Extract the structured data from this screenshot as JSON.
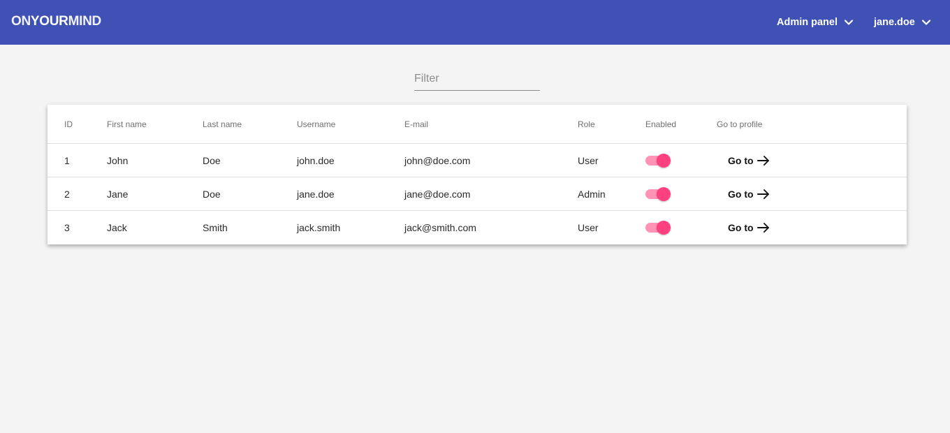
{
  "app": {
    "logo_part1": "ON",
    "logo_part2": "YOUR",
    "logo_part3": "MIND"
  },
  "toolbar": {
    "admin_menu_label": "Admin panel",
    "user_menu_label": "jane.doe",
    "chevron_icon": "chevron-down-icon"
  },
  "filter": {
    "placeholder": "Filter",
    "value": ""
  },
  "table": {
    "headers": {
      "id": "ID",
      "first_name": "First name",
      "last_name": "Last name",
      "username": "Username",
      "email": "E-mail",
      "role": "Role",
      "enabled": "Enabled",
      "go_to_profile": "Go to profile"
    },
    "rows": [
      {
        "id": "1",
        "first_name": "John",
        "last_name": "Doe",
        "username": "john.doe",
        "email": "john@doe.com",
        "role": "User",
        "enabled": true,
        "go_label": "Go to"
      },
      {
        "id": "2",
        "first_name": "Jane",
        "last_name": "Doe",
        "username": "jane.doe",
        "email": "jane@doe.com",
        "role": "Admin",
        "enabled": true,
        "go_label": "Go to"
      },
      {
        "id": "3",
        "first_name": "Jack",
        "last_name": "Smith",
        "username": "jack.smith",
        "email": "jack@smith.com",
        "role": "User",
        "enabled": true,
        "go_label": "Go to"
      }
    ]
  },
  "colors": {
    "toolbar": "#3f51b5",
    "background": "#f4f4f4",
    "toggle_thumb": "#ff4081",
    "toggle_track": "#ff93b5"
  }
}
